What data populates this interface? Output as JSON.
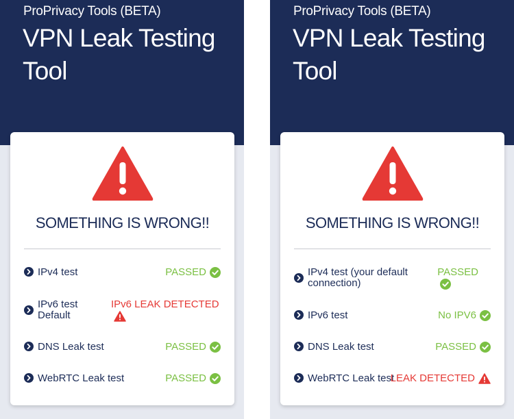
{
  "colors": {
    "navy": "#1c2c57",
    "pass_green": "#7bc043",
    "fail_red": "#e53935",
    "warning_red": "#e53935"
  },
  "panels": [
    {
      "brand": "ProPrivacy Tools (BETA)",
      "title": "VPN Leak Testing Tool",
      "headline": "SOMETHING IS WRONG!!",
      "warning_icon": "warning-triangle-icon",
      "tests": [
        {
          "label": "IPv4 test",
          "status": "PASSED",
          "state": "pass",
          "icon": "check-circle-icon"
        },
        {
          "label": "IPv6 test Default",
          "status": "IPv6 LEAK DETECTED",
          "state": "fail",
          "icon": "warning-triangle-icon"
        },
        {
          "label": "DNS Leak test",
          "status": "PASSED",
          "state": "pass",
          "icon": "check-circle-icon"
        },
        {
          "label": "WebRTC Leak test",
          "status": "PASSED",
          "state": "pass",
          "icon": "check-circle-icon"
        }
      ]
    },
    {
      "brand": "ProPrivacy Tools (BETA)",
      "title": "VPN Leak Testing Tool",
      "headline": "SOMETHING IS WRONG!!",
      "warning_icon": "warning-triangle-icon",
      "tests": [
        {
          "label": "IPv4 test (your default connection)",
          "status": "PASSED",
          "state": "pass",
          "icon": "check-circle-icon"
        },
        {
          "label": "IPv6 test",
          "status": "No IPV6",
          "state": "pass",
          "icon": "check-circle-icon"
        },
        {
          "label": "DNS Leak test",
          "status": "PASSED",
          "state": "pass",
          "icon": "check-circle-icon"
        },
        {
          "label": "WebRTC Leak test",
          "status": "LEAK DETECTED",
          "state": "fail",
          "icon": "warning-triangle-icon"
        }
      ]
    }
  ]
}
